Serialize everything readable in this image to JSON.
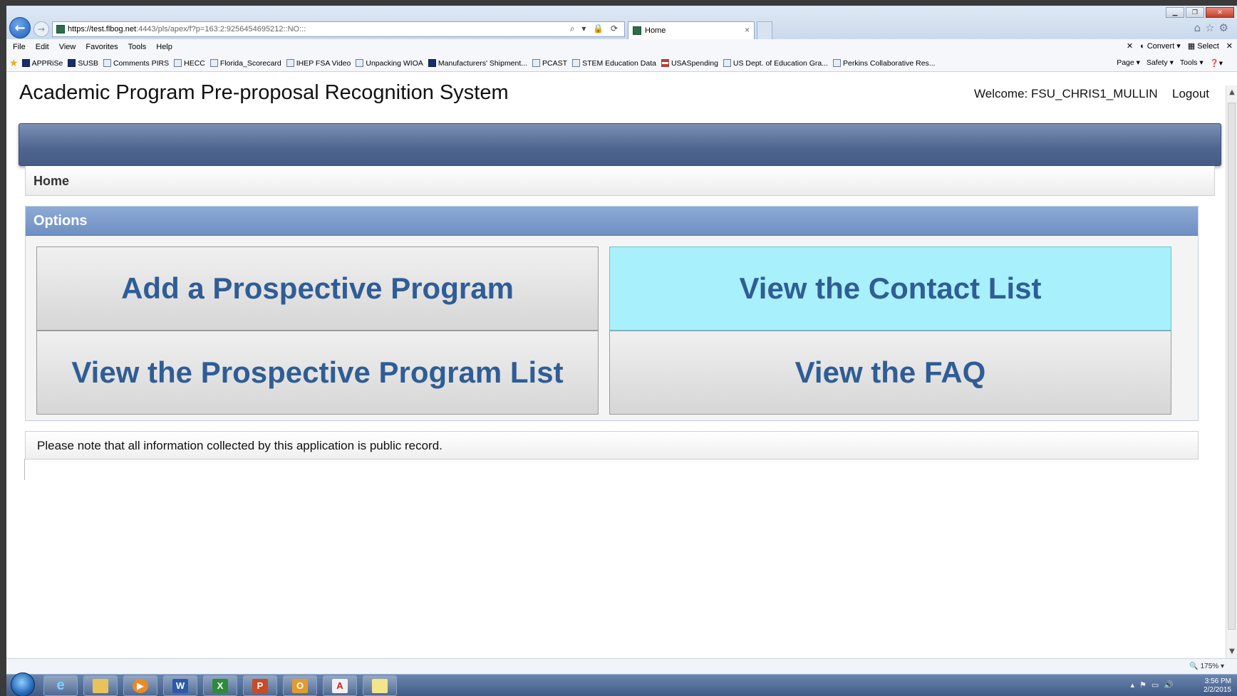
{
  "browser": {
    "url_host": "https://test.flbog.net",
    "url_rest": ":4443/pls/apex/f?p=163:2:9256454695212::NO:::",
    "tab_title": "Home",
    "menu": [
      "File",
      "Edit",
      "View",
      "Favorites",
      "Tools",
      "Help"
    ],
    "menu_right": [
      "Convert",
      "Select"
    ],
    "favorites": [
      "APPRiSe",
      "SUSB",
      "Comments PIRS",
      "HECC",
      "Florida_Scorecard",
      "IHEP FSA Video",
      "Unpacking WIOA",
      "Manufacturers' Shipment...",
      "PCAST",
      "STEM Education Data",
      "USASpending",
      "US Dept. of Education Gra...",
      "Perkins Collaborative Res..."
    ],
    "command_bar": [
      "Page",
      "Safety",
      "Tools"
    ],
    "zoom": "175%"
  },
  "app": {
    "title": "Academic Program Pre-proposal Recognition System",
    "welcome": "Welcome: FSU_CHRIS1_MULLIN",
    "logout": "Logout",
    "breadcrumb": "Home",
    "options_title": "Options",
    "buttons": {
      "add_program": "Add a Prospective Program",
      "contact_list": "View the Contact List",
      "program_list": "View the Prospective Program List",
      "faq": "View the FAQ"
    },
    "notice": "Please note that all information collected by this application is public record."
  },
  "taskbar": {
    "apps": [
      "internet-explorer",
      "file-explorer",
      "media-player",
      "word",
      "excel",
      "powerpoint",
      "outlook",
      "acrobat",
      "sticky-notes"
    ],
    "time": "3:56 PM",
    "date": "2/2/2015"
  },
  "colors": {
    "banner": "#4e6590",
    "options_header": "#7b99c9",
    "button_text": "#2f5d95",
    "button_hover": "#a8f0fb"
  }
}
